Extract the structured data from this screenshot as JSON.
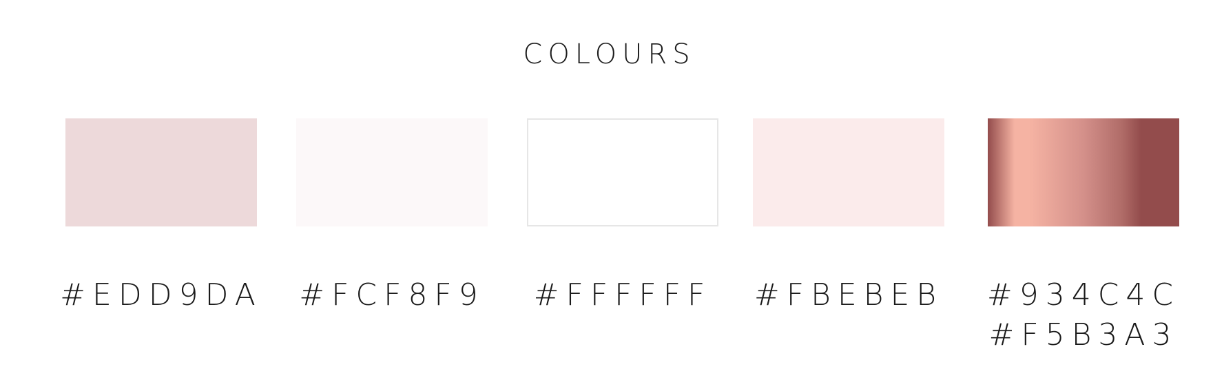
{
  "title": "COLOURS",
  "swatches": [
    {
      "label_lines": [
        "#EDD9DA"
      ],
      "color": "#EDD9DA",
      "border": "none"
    },
    {
      "label_lines": [
        "#FCF8F9"
      ],
      "color": "#FCF8F9",
      "border": "none"
    },
    {
      "label_lines": [
        "#FFFFFF"
      ],
      "color": "#FFFFFF",
      "border": "#E6E6E6"
    },
    {
      "label_lines": [
        "#FBEBEB"
      ],
      "color": "#FBEBEB",
      "border": "none"
    },
    {
      "label_lines": [
        "#934C4C",
        "#F5B3A3"
      ],
      "gradient_colors": [
        "#934C4C",
        "#F5B3A3"
      ]
    }
  ]
}
